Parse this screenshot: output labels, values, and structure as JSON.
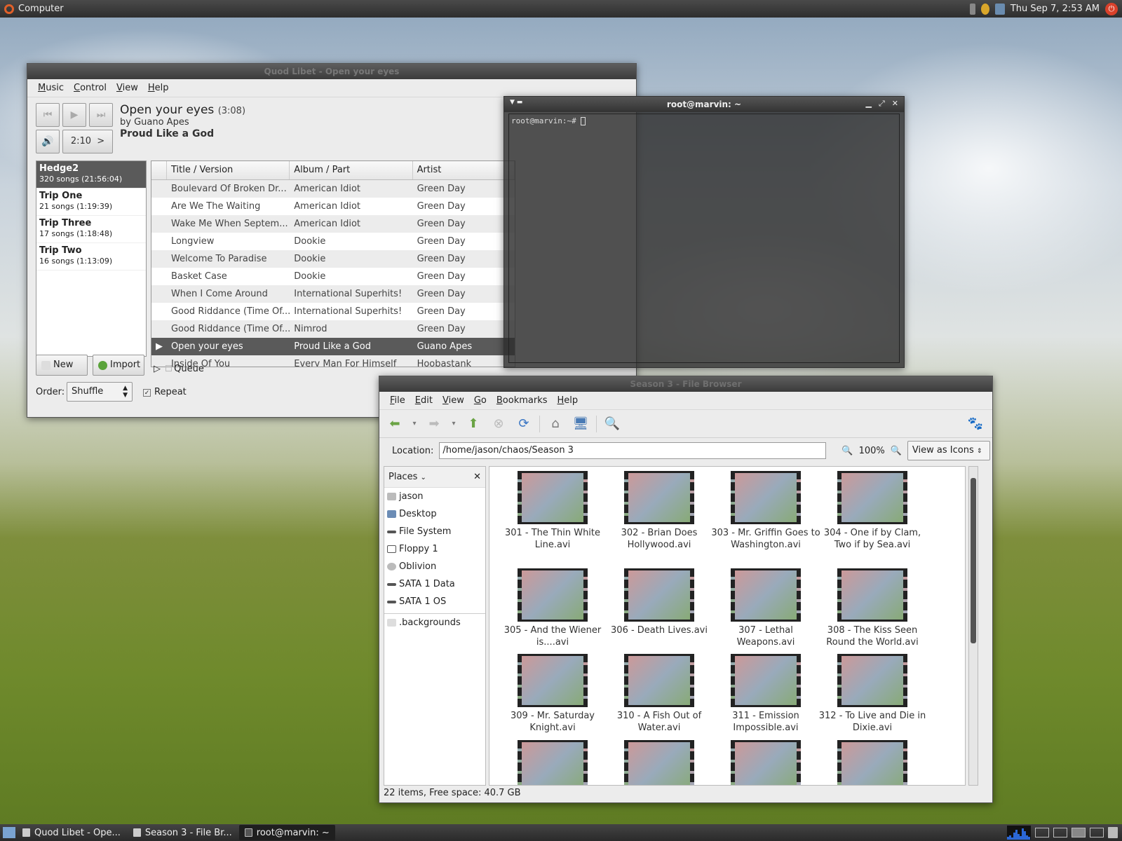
{
  "top_panel": {
    "menu_label": "Computer",
    "clock": "Thu Sep  7,  2:53 AM"
  },
  "quodlibet": {
    "title": "Quod Libet - Open your eyes",
    "menu": [
      "Music",
      "Control",
      "View",
      "Help"
    ],
    "now_playing": {
      "title": "Open your eyes",
      "length": "(3:08)",
      "by": "by Guano Apes",
      "album": "Proud Like a God"
    },
    "position": "2:10",
    "position_arrow": ">",
    "playlists": [
      {
        "name": "Hedge2",
        "info": "320 songs (21:56:04)"
      },
      {
        "name": "Trip One",
        "info": "21 songs (1:19:39)"
      },
      {
        "name": "Trip Three",
        "info": "17 songs (1:18:48)"
      },
      {
        "name": "Trip Two",
        "info": "16 songs (1:13:09)"
      }
    ],
    "columns": [
      "Title / Version",
      "Album / Part",
      "Artist"
    ],
    "songs": [
      [
        "Boulevard Of Broken Dr...",
        "American Idiot",
        "Green Day"
      ],
      [
        "Are We The Waiting",
        "American Idiot",
        "Green Day"
      ],
      [
        "Wake Me When Septem...",
        "American Idiot",
        "Green Day"
      ],
      [
        "Longview",
        "Dookie",
        "Green Day"
      ],
      [
        "Welcome To Paradise",
        "Dookie",
        "Green Day"
      ],
      [
        "Basket Case",
        "Dookie",
        "Green Day"
      ],
      [
        "When I Come Around",
        "International Superhits!",
        "Green Day"
      ],
      [
        "Good Riddance (Time Of...",
        "International Superhits!",
        "Green Day"
      ],
      [
        "Good Riddance (Time Of...",
        "Nimrod",
        "Green Day"
      ],
      [
        "Open your eyes",
        "Proud Like a God",
        "Guano Apes"
      ],
      [
        "Inside Of You",
        "Every Man For Himself",
        "Hoobastank"
      ]
    ],
    "new_label": "New",
    "import_label": "Import",
    "queue_label": "Queue",
    "order_label": "Order:",
    "order_value": "Shuffle",
    "repeat_label": "Repeat"
  },
  "terminal": {
    "title": "root@marvin: ~",
    "prompt": "root@marvin:~# "
  },
  "filebrowser": {
    "title": "Season 3 - File Browser",
    "menu": [
      "File",
      "Edit",
      "View",
      "Go",
      "Bookmarks",
      "Help"
    ],
    "location_label": "Location:",
    "location_value": "/home/jason/chaos/Season 3",
    "zoom": "100%",
    "view_mode": "View as Icons",
    "places_label": "Places",
    "places": [
      "jason",
      "Desktop",
      "File System",
      "Floppy 1",
      "Oblivion",
      "SATA 1 Data",
      "SATA 1 OS"
    ],
    "extra_place": ".backgrounds",
    "files": [
      "301 - The Thin White Line.avi",
      "302 - Brian Does Hollywood.avi",
      "303 - Mr. Griffin Goes to Washington.avi",
      "304 - One if by Clam, Two if by Sea.avi",
      "305 - And the Wiener is....avi",
      "306 - Death Lives.avi",
      "307 - Lethal Weapons.avi",
      "308 - The Kiss Seen Round the World.avi",
      "309 - Mr. Saturday Knight.avi",
      "310 - A Fish Out of Water.avi",
      "311 - Emission Impossible.avi",
      "312 - To Live and Die in Dixie.avi"
    ],
    "status": "22 items, Free space: 40.7 GB"
  },
  "taskbar": [
    "Quod Libet - Ope...",
    "Season 3 - File Br...",
    "root@marvin: ~"
  ]
}
